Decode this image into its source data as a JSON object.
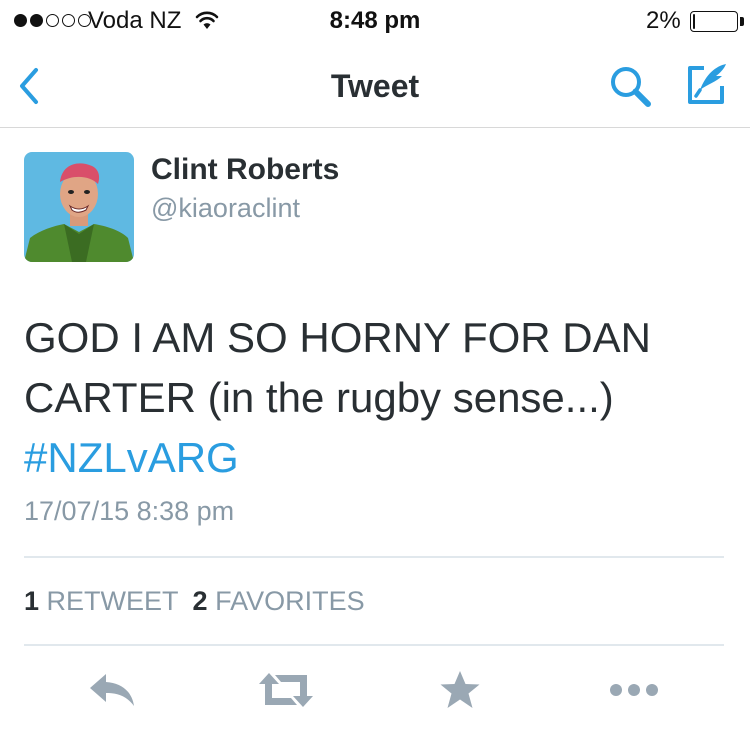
{
  "status_bar": {
    "signal_bars_filled": 2,
    "signal_bars_total": 5,
    "carrier": "Voda NZ",
    "time": "8:48 pm",
    "battery_percent_label": "2%",
    "battery_level": 0.02
  },
  "nav": {
    "title": "Tweet",
    "back_icon": "chevron-left-icon",
    "search_icon": "search-icon",
    "compose_icon": "compose-feather-icon"
  },
  "tweet": {
    "author_name": "Clint Roberts",
    "author_handle": "@kiaoraclint",
    "text_line1": "GOD I AM SO HORNY FOR DAN",
    "text_line2": "CARTER (in the rugby sense...)",
    "hashtag": "#NZLvARG",
    "timestamp": "17/07/15 8:38 pm"
  },
  "stats": {
    "retweets_count": "1",
    "retweets_label": "RETWEET",
    "favorites_count": "2",
    "favorites_label": "FAVORITES"
  },
  "actions": {
    "reply_icon": "reply-icon",
    "retweet_icon": "retweet-icon",
    "favorite_icon": "star-icon",
    "more_icon": "more-dots-icon"
  },
  "colors": {
    "accent": "#2a9de0",
    "text": "#292f33",
    "muted": "#8899a6",
    "icon_gray": "#9aa8b4",
    "divider": "#e1e8ed"
  }
}
